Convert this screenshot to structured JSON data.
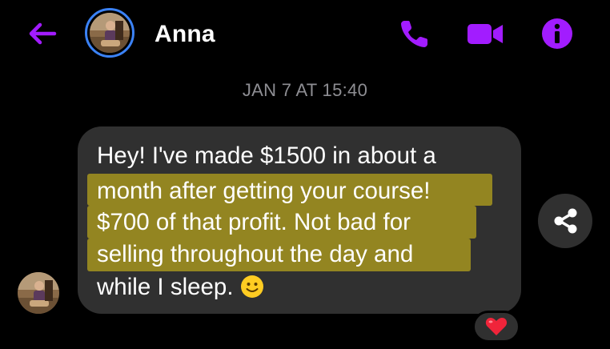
{
  "header": {
    "contact_name": "Anna",
    "back_icon": "arrow-left-icon",
    "call_icon": "phone-icon",
    "video_icon": "video-camera-icon",
    "info_icon": "info-icon",
    "accent_color": "#a21cff",
    "avatar_ring_color": "#3b82f6"
  },
  "conversation": {
    "timestamp": "JAN 7 AT 15:40",
    "messages": [
      {
        "sender": "Anna",
        "lines": [
          "Hey! I've made $1500 in about a",
          "month after getting your course!",
          "$700 of that profit. Not bad for",
          "selling throughout the day and",
          "while I sleep."
        ],
        "emoji": "slightly-smiling-face",
        "highlight_color": "#a5941e",
        "reaction": "heart",
        "share_icon": "share-icon"
      }
    ]
  }
}
